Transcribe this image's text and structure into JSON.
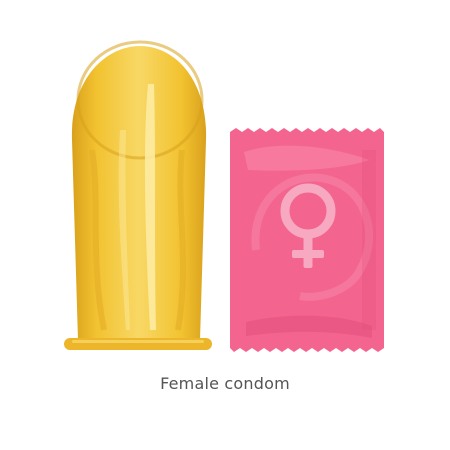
{
  "caption": "Female condom",
  "colors": {
    "condom_base": "#F2C230",
    "condom_light": "#F8D865",
    "condom_dark": "#D9A11C",
    "condom_highlight": "#FDEBA2",
    "packet_base": "#F3648E",
    "packet_light": "#F98AAC",
    "packet_dark": "#E04B79",
    "symbol": "#F7A9C2"
  },
  "icons": {
    "packet_symbol": "female-symbol-icon"
  }
}
